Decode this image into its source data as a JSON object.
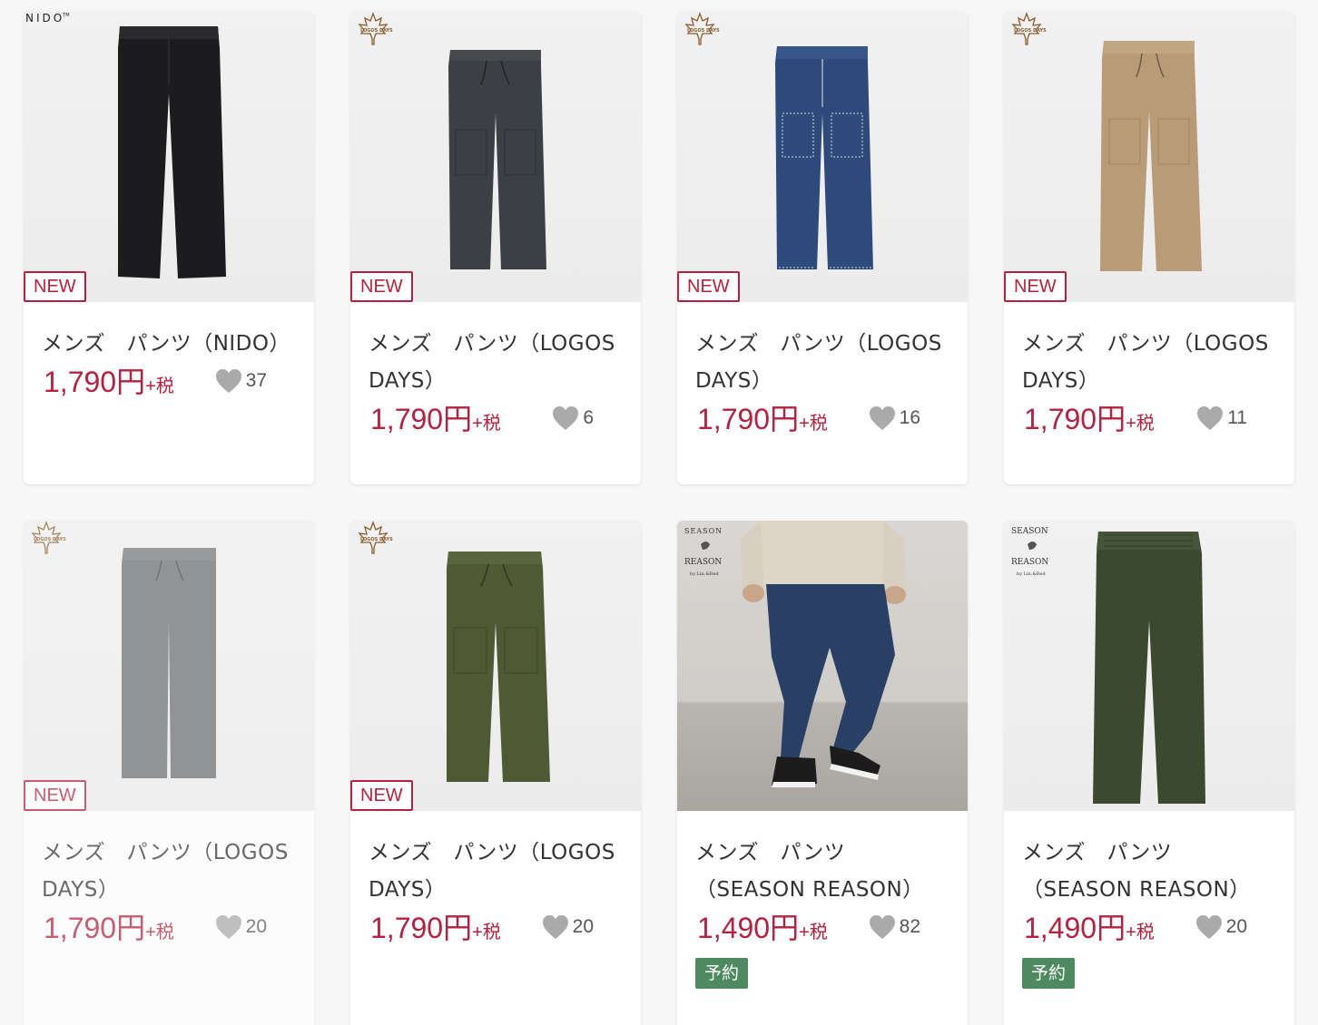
{
  "colors": {
    "price": "#b6213f",
    "new_badge": "#b6213f",
    "reserve_badge": "#4d8a60",
    "heart": "#aaaaaa"
  },
  "products": [
    {
      "brand": "NIDO",
      "brand_icon": "nido-logo",
      "badge": "NEW",
      "title": "メンズ　パンツ（NIDO）",
      "price": "1,790円",
      "tax": "+税",
      "likes": "37",
      "pants_color": "#1c1c1e"
    },
    {
      "brand": "LOGOS DAYS",
      "brand_icon": "logos-days-logo",
      "badge": "NEW",
      "title": "メンズ　パンツ（LOGOS DAYS）",
      "price": "1,790円",
      "tax": "+税",
      "likes": "6",
      "pants_color": "#3c3f43"
    },
    {
      "brand": "LOGOS DAYS",
      "brand_icon": "logos-days-logo",
      "badge": "NEW",
      "title": "メンズ　パンツ（LOGOS DAYS）",
      "price": "1,790円",
      "tax": "+税",
      "likes": "16",
      "pants_color": "#2d4a7a"
    },
    {
      "brand": "LOGOS DAYS",
      "brand_icon": "logos-days-logo",
      "badge": "NEW",
      "title": "メンズ　パンツ（LOGOS DAYS）",
      "price": "1,790円",
      "tax": "+税",
      "likes": "11",
      "pants_color": "#b89c78"
    },
    {
      "brand": "LOGOS DAYS",
      "brand_icon": "logos-days-logo",
      "badge": "NEW",
      "title": "メンズ　パンツ（LOGOS DAYS）",
      "price": "1,790円",
      "tax": "+税",
      "likes": "20",
      "pants_color": "#6a6d70"
    },
    {
      "brand": "LOGOS DAYS",
      "brand_icon": "logos-days-logo",
      "badge": "NEW",
      "title": "メンズ　パンツ（LOGOS DAYS）",
      "price": "1,790円",
      "tax": "+税",
      "likes": "20",
      "pants_color": "#4f5a34"
    },
    {
      "brand": "SEASON REASON",
      "brand_icon": "season-reason-logo",
      "brand_by": "by Lin.&Red",
      "title": "メンズ　パンツ（SEASON REASON）",
      "price": "1,490円",
      "tax": "+税",
      "likes": "82",
      "reserve": "予約",
      "pants_color": "#2a3f66"
    },
    {
      "brand": "SEASON REASON",
      "brand_icon": "season-reason-logo",
      "brand_by": "by Lin.&Red",
      "title": "メンズ　パンツ（SEASON REASON）",
      "price": "1,490円",
      "tax": "+税",
      "likes": "20",
      "reserve": "予約",
      "pants_color": "#3b4a2e"
    }
  ]
}
